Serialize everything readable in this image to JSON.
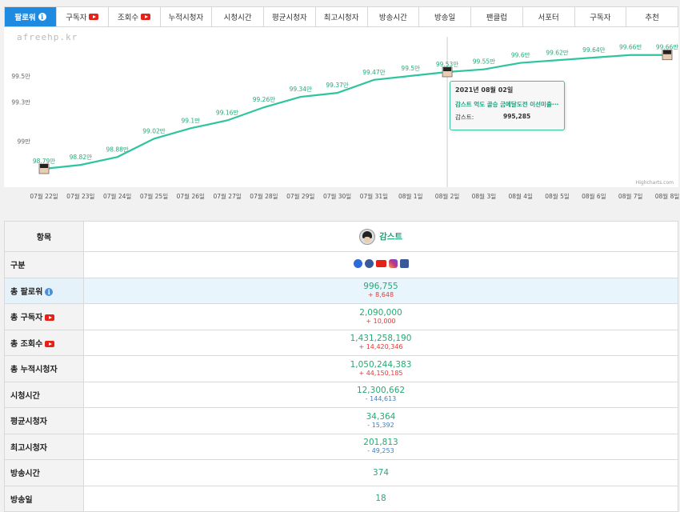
{
  "tabs": [
    {
      "label": "팔로워",
      "active": true,
      "icon": "info"
    },
    {
      "label": "구독자",
      "icon": "youtube"
    },
    {
      "label": "조회수",
      "icon": "youtube"
    },
    {
      "label": "누적시청자"
    },
    {
      "label": "시청시간"
    },
    {
      "label": "평균시청자"
    },
    {
      "label": "최고시청자"
    },
    {
      "label": "방송시간"
    },
    {
      "label": "방송일"
    },
    {
      "label": "팬클럽"
    },
    {
      "label": "서포터"
    },
    {
      "label": "구독자"
    },
    {
      "label": "추천"
    }
  ],
  "watermark": "afreehp.kr",
  "credits": "Highcharts.com",
  "chart_data": {
    "type": "line",
    "x": [
      "07월 22일",
      "07월 23일",
      "07월 24일",
      "07월 25일",
      "07월 26일",
      "07월 27일",
      "07월 28일",
      "07월 29일",
      "07월 30일",
      "07월 31일",
      "08월 1일",
      "08월 2일",
      "08월 3일",
      "08월 4일",
      "08월 5일",
      "08월 6일",
      "08월 7일",
      "08월 8일"
    ],
    "values": [
      98.79,
      98.82,
      98.88,
      99.02,
      99.1,
      99.16,
      99.26,
      99.34,
      99.37,
      99.47,
      99.5,
      99.53,
      99.55,
      99.6,
      99.62,
      99.64,
      99.66,
      99.66
    ],
    "point_labels": [
      "98.79만",
      "98.82만",
      "98.88만",
      "99.02만",
      "99.1만",
      "99.16만",
      "99.26만",
      "99.34만",
      "99.37만",
      "99.47만",
      "99.5만",
      "99.53만",
      "99.55만",
      "99.6만",
      "99.62만",
      "99.64만",
      "99.66만",
      "99.66만"
    ],
    "y_ticks": [
      {
        "value": 99.0,
        "label": "99만"
      },
      {
        "value": 99.3,
        "label": "99.3만"
      },
      {
        "value": 99.5,
        "label": "99.5만"
      }
    ],
    "ylim": [
      98.68,
      99.75
    ],
    "grid": false,
    "line_color": "#2ec4a0",
    "avatar_points": [
      0,
      11,
      17
    ],
    "crosshair_index": 11
  },
  "tooltip": {
    "date": "2021년 08월 02일",
    "title": "감스트 억도 골승 금메달도전 이선미출···",
    "name": "감스트:",
    "value": "995,285"
  },
  "table": {
    "header_label": "항목",
    "bj_name": "감스트",
    "rows": [
      {
        "label": "구분",
        "type": "platforms"
      },
      {
        "label": "총 팔로워",
        "icon": "info",
        "value": "996,755",
        "delta": "+ 8,648",
        "dir": "up",
        "highlight": true
      },
      {
        "label": "총 구독자",
        "icon": "youtube",
        "value": "2,090,000",
        "delta": "+ 10,000",
        "dir": "up"
      },
      {
        "label": "총 조회수",
        "icon": "youtube",
        "value": "1,431,258,190",
        "delta": "+ 14,420,346",
        "dir": "up"
      },
      {
        "label": "총 누적시청자",
        "value": "1,050,244,383",
        "delta": "+ 44,150,185",
        "dir": "up"
      },
      {
        "label": "시청시간",
        "value": "12,300,662",
        "delta": "- 144,613",
        "dir": "down"
      },
      {
        "label": "평균시청자",
        "value": "34,364",
        "delta": "- 15,392",
        "dir": "down"
      },
      {
        "label": "최고시청자",
        "value": "201,813",
        "delta": "- 49,253",
        "dir": "down"
      },
      {
        "label": "방송시간",
        "value": "374"
      },
      {
        "label": "방송일",
        "value": "18"
      }
    ]
  },
  "platform_icons": [
    {
      "name": "afreeca-icon",
      "color": "#2d6bd8"
    },
    {
      "name": "afreeca-bj-icon",
      "color": "#3a5a9a"
    },
    {
      "name": "youtube-icon",
      "color": "#e62117"
    },
    {
      "name": "instagram-icon",
      "color": "#c13584"
    },
    {
      "name": "facebook-icon",
      "color": "#3b5998"
    }
  ]
}
